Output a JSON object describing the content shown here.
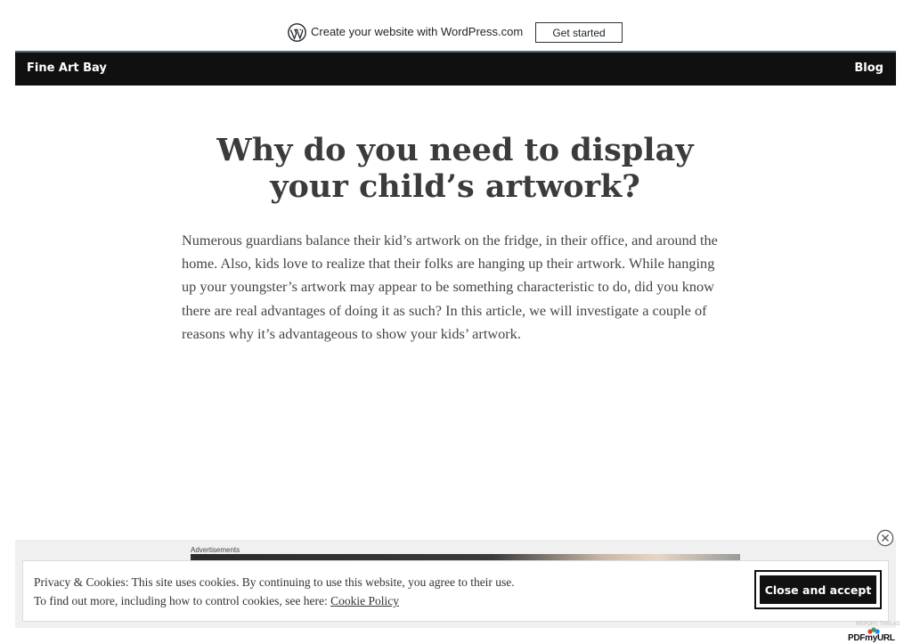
{
  "promo_bar": {
    "text": "Create your website with WordPress.com",
    "button_label": "Get started",
    "icon": "wordpress-logo-icon"
  },
  "site": {
    "title": "Fine Art Bay",
    "nav": {
      "blog": "Blog"
    },
    "header_color": "#101010"
  },
  "article": {
    "title": "Why do you need to display your child’s artwork?",
    "body": "Numerous guardians balance their kid’s artwork on the fridge, in their office, and around the home. Also, kids love to realize that their folks are hanging up their artwork. While hanging up your youngster’s artwork may appear to be something characteristic to do, did you know there are real advantages of doing it as such? In this article, we will investigate a couple of reasons why it’s advantageous to show your kids’ artwork."
  },
  "ad": {
    "label": "Advertisements",
    "close_icon": "close-circle-icon"
  },
  "cookie_banner": {
    "line1": "Privacy & Cookies: This site uses cookies. By continuing to use this website, you agree to their use.",
    "line2_prefix": "To find out more, including how to control cookies, see here: ",
    "policy_link": "Cookie Policy",
    "accept_button": "Close and accept"
  },
  "footer": {
    "report_ad": "REPORT THIS AD",
    "pdf_badge": "PDFmyURL"
  }
}
